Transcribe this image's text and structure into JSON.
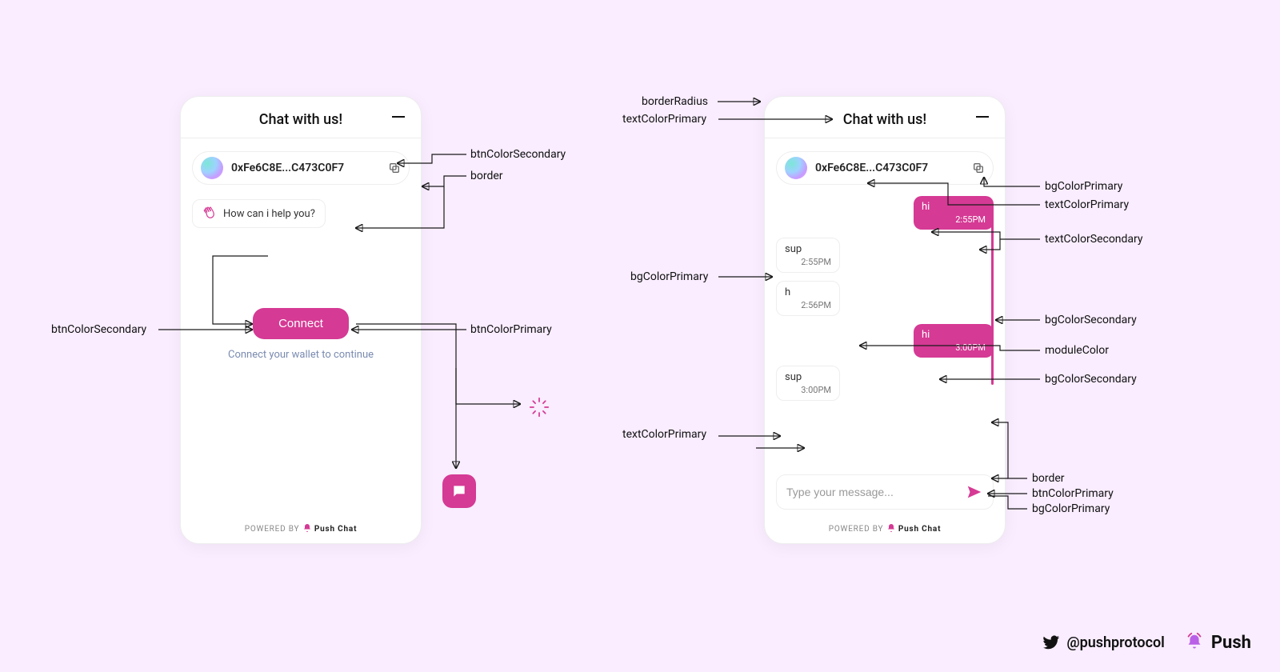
{
  "left": {
    "title": "Chat with us!",
    "address": "0xFe6C8E...C473C0F7",
    "helpText": "How can i help you?",
    "connectLabel": "Connect",
    "connectCaption": "Connect your wallet to continue",
    "poweredPrefix": "POWERED BY",
    "poweredBrand": "Push Chat"
  },
  "right": {
    "title": "Chat with us!",
    "address": "0xFe6C8E...C473C0F7",
    "messages": [
      {
        "side": "self",
        "text": "hi",
        "time": "2:55PM"
      },
      {
        "side": "peer",
        "text": "sup",
        "time": "2:55PM"
      },
      {
        "side": "peer",
        "text": "h",
        "time": "2:56PM"
      },
      {
        "side": "self",
        "text": "hi",
        "time": "3:00PM"
      },
      {
        "side": "peer",
        "text": "sup",
        "time": "3:00PM"
      }
    ],
    "inputPlaceholder": "Type your message...",
    "poweredPrefix": "POWERED BY",
    "poweredBrand": "Push Chat"
  },
  "annotations": {
    "a1": "btnColorSecondary",
    "a2": "border",
    "a3": "btnColorPrimary",
    "a4": "btnColorSecondary",
    "r1": "borderRadius",
    "r2": "textColorPrimary",
    "r3": "bgColorPrimary",
    "r4": "textColorPrimary",
    "r5": "textColorSecondary",
    "r6": "bgColorPrimary",
    "r7": "bgColorSecondary",
    "r8": "moduleColor",
    "r9": "bgColorSecondary",
    "r10": "textColorPrimary",
    "r11": "border",
    "r12": "btnColorPrimary",
    "r13": "bgColorPrimary"
  },
  "footer": {
    "twitter": "@pushprotocol",
    "brand": "Push"
  }
}
